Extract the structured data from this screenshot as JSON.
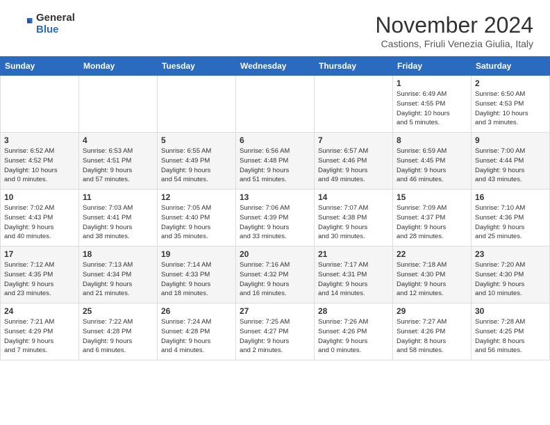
{
  "logo": {
    "general": "General",
    "blue": "Blue"
  },
  "title": "November 2024",
  "subtitle": "Castions, Friuli Venezia Giulia, Italy",
  "days_header": [
    "Sunday",
    "Monday",
    "Tuesday",
    "Wednesday",
    "Thursday",
    "Friday",
    "Saturday"
  ],
  "weeks": [
    [
      {
        "day": "",
        "info": ""
      },
      {
        "day": "",
        "info": ""
      },
      {
        "day": "",
        "info": ""
      },
      {
        "day": "",
        "info": ""
      },
      {
        "day": "",
        "info": ""
      },
      {
        "day": "1",
        "info": "Sunrise: 6:49 AM\nSunset: 4:55 PM\nDaylight: 10 hours\nand 5 minutes."
      },
      {
        "day": "2",
        "info": "Sunrise: 6:50 AM\nSunset: 4:53 PM\nDaylight: 10 hours\nand 3 minutes."
      }
    ],
    [
      {
        "day": "3",
        "info": "Sunrise: 6:52 AM\nSunset: 4:52 PM\nDaylight: 10 hours\nand 0 minutes."
      },
      {
        "day": "4",
        "info": "Sunrise: 6:53 AM\nSunset: 4:51 PM\nDaylight: 9 hours\nand 57 minutes."
      },
      {
        "day": "5",
        "info": "Sunrise: 6:55 AM\nSunset: 4:49 PM\nDaylight: 9 hours\nand 54 minutes."
      },
      {
        "day": "6",
        "info": "Sunrise: 6:56 AM\nSunset: 4:48 PM\nDaylight: 9 hours\nand 51 minutes."
      },
      {
        "day": "7",
        "info": "Sunrise: 6:57 AM\nSunset: 4:46 PM\nDaylight: 9 hours\nand 49 minutes."
      },
      {
        "day": "8",
        "info": "Sunrise: 6:59 AM\nSunset: 4:45 PM\nDaylight: 9 hours\nand 46 minutes."
      },
      {
        "day": "9",
        "info": "Sunrise: 7:00 AM\nSunset: 4:44 PM\nDaylight: 9 hours\nand 43 minutes."
      }
    ],
    [
      {
        "day": "10",
        "info": "Sunrise: 7:02 AM\nSunset: 4:43 PM\nDaylight: 9 hours\nand 40 minutes."
      },
      {
        "day": "11",
        "info": "Sunrise: 7:03 AM\nSunset: 4:41 PM\nDaylight: 9 hours\nand 38 minutes."
      },
      {
        "day": "12",
        "info": "Sunrise: 7:05 AM\nSunset: 4:40 PM\nDaylight: 9 hours\nand 35 minutes."
      },
      {
        "day": "13",
        "info": "Sunrise: 7:06 AM\nSunset: 4:39 PM\nDaylight: 9 hours\nand 33 minutes."
      },
      {
        "day": "14",
        "info": "Sunrise: 7:07 AM\nSunset: 4:38 PM\nDaylight: 9 hours\nand 30 minutes."
      },
      {
        "day": "15",
        "info": "Sunrise: 7:09 AM\nSunset: 4:37 PM\nDaylight: 9 hours\nand 28 minutes."
      },
      {
        "day": "16",
        "info": "Sunrise: 7:10 AM\nSunset: 4:36 PM\nDaylight: 9 hours\nand 25 minutes."
      }
    ],
    [
      {
        "day": "17",
        "info": "Sunrise: 7:12 AM\nSunset: 4:35 PM\nDaylight: 9 hours\nand 23 minutes."
      },
      {
        "day": "18",
        "info": "Sunrise: 7:13 AM\nSunset: 4:34 PM\nDaylight: 9 hours\nand 21 minutes."
      },
      {
        "day": "19",
        "info": "Sunrise: 7:14 AM\nSunset: 4:33 PM\nDaylight: 9 hours\nand 18 minutes."
      },
      {
        "day": "20",
        "info": "Sunrise: 7:16 AM\nSunset: 4:32 PM\nDaylight: 9 hours\nand 16 minutes."
      },
      {
        "day": "21",
        "info": "Sunrise: 7:17 AM\nSunset: 4:31 PM\nDaylight: 9 hours\nand 14 minutes."
      },
      {
        "day": "22",
        "info": "Sunrise: 7:18 AM\nSunset: 4:30 PM\nDaylight: 9 hours\nand 12 minutes."
      },
      {
        "day": "23",
        "info": "Sunrise: 7:20 AM\nSunset: 4:30 PM\nDaylight: 9 hours\nand 10 minutes."
      }
    ],
    [
      {
        "day": "24",
        "info": "Sunrise: 7:21 AM\nSunset: 4:29 PM\nDaylight: 9 hours\nand 7 minutes."
      },
      {
        "day": "25",
        "info": "Sunrise: 7:22 AM\nSunset: 4:28 PM\nDaylight: 9 hours\nand 6 minutes."
      },
      {
        "day": "26",
        "info": "Sunrise: 7:24 AM\nSunset: 4:28 PM\nDaylight: 9 hours\nand 4 minutes."
      },
      {
        "day": "27",
        "info": "Sunrise: 7:25 AM\nSunset: 4:27 PM\nDaylight: 9 hours\nand 2 minutes."
      },
      {
        "day": "28",
        "info": "Sunrise: 7:26 AM\nSunset: 4:26 PM\nDaylight: 9 hours\nand 0 minutes."
      },
      {
        "day": "29",
        "info": "Sunrise: 7:27 AM\nSunset: 4:26 PM\nDaylight: 8 hours\nand 58 minutes."
      },
      {
        "day": "30",
        "info": "Sunrise: 7:28 AM\nSunset: 4:25 PM\nDaylight: 8 hours\nand 56 minutes."
      }
    ]
  ]
}
